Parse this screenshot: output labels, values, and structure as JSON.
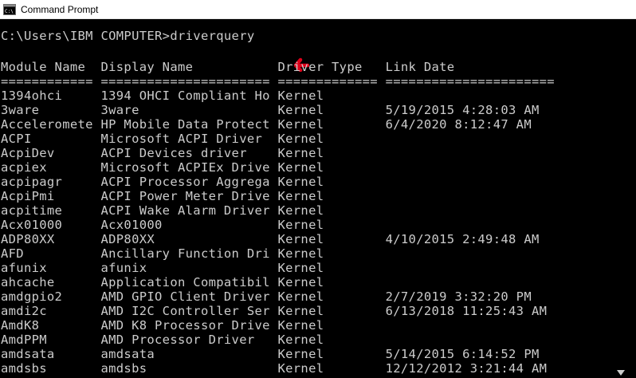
{
  "window": {
    "title": "Command Prompt",
    "icon": "cmd-icon",
    "colors": {
      "background": "#000000",
      "text": "#cccccc",
      "annotation": "#e0001a"
    }
  },
  "console": {
    "prompt": "C:\\Users\\IBM COMPUTER>",
    "command": "driverquery",
    "header_line": "Module Name  Display Name           Driver Type   Link Date",
    "separator_line": "============ ====================== ============= ======================",
    "rows": [
      "1394ohci     1394 OHCI Compliant Ho Kernel",
      "3ware        3ware                  Kernel        5/19/2015 4:28:03 AM",
      "Acceleromete HP Mobile Data Protect Kernel        6/4/2020 8:12:47 AM",
      "ACPI         Microsoft ACPI Driver  Kernel",
      "AcpiDev      ACPI Devices driver    Kernel",
      "acpiex       Microsoft ACPIEx Drive Kernel",
      "acpipagr     ACPI Processor Aggrega Kernel",
      "AcpiPmi      ACPI Power Meter Drive Kernel",
      "acpitime     ACPI Wake Alarm Driver Kernel",
      "Acx01000     Acx01000               Kernel",
      "ADP80XX      ADP80XX                Kernel        4/10/2015 2:49:48 AM",
      "AFD          Ancillary Function Dri Kernel",
      "afunix       afunix                 Kernel",
      "ahcache      Application Compatibil Kernel",
      "amdgpio2     AMD GPIO Client Driver Kernel        2/7/2019 3:32:20 PM",
      "amdi2c       AMD I2C Controller Ser Kernel        6/13/2018 11:25:43 AM",
      "AmdK8        AMD K8 Processor Drive Kernel",
      "AmdPPM       AMD Processor Driver   Kernel",
      "amdsata      amdsata                Kernel        5/14/2015 6:14:52 PM",
      "amdsbs       amdsbs                 Kernel        12/12/2012 3:21:44 AM"
    ]
  }
}
